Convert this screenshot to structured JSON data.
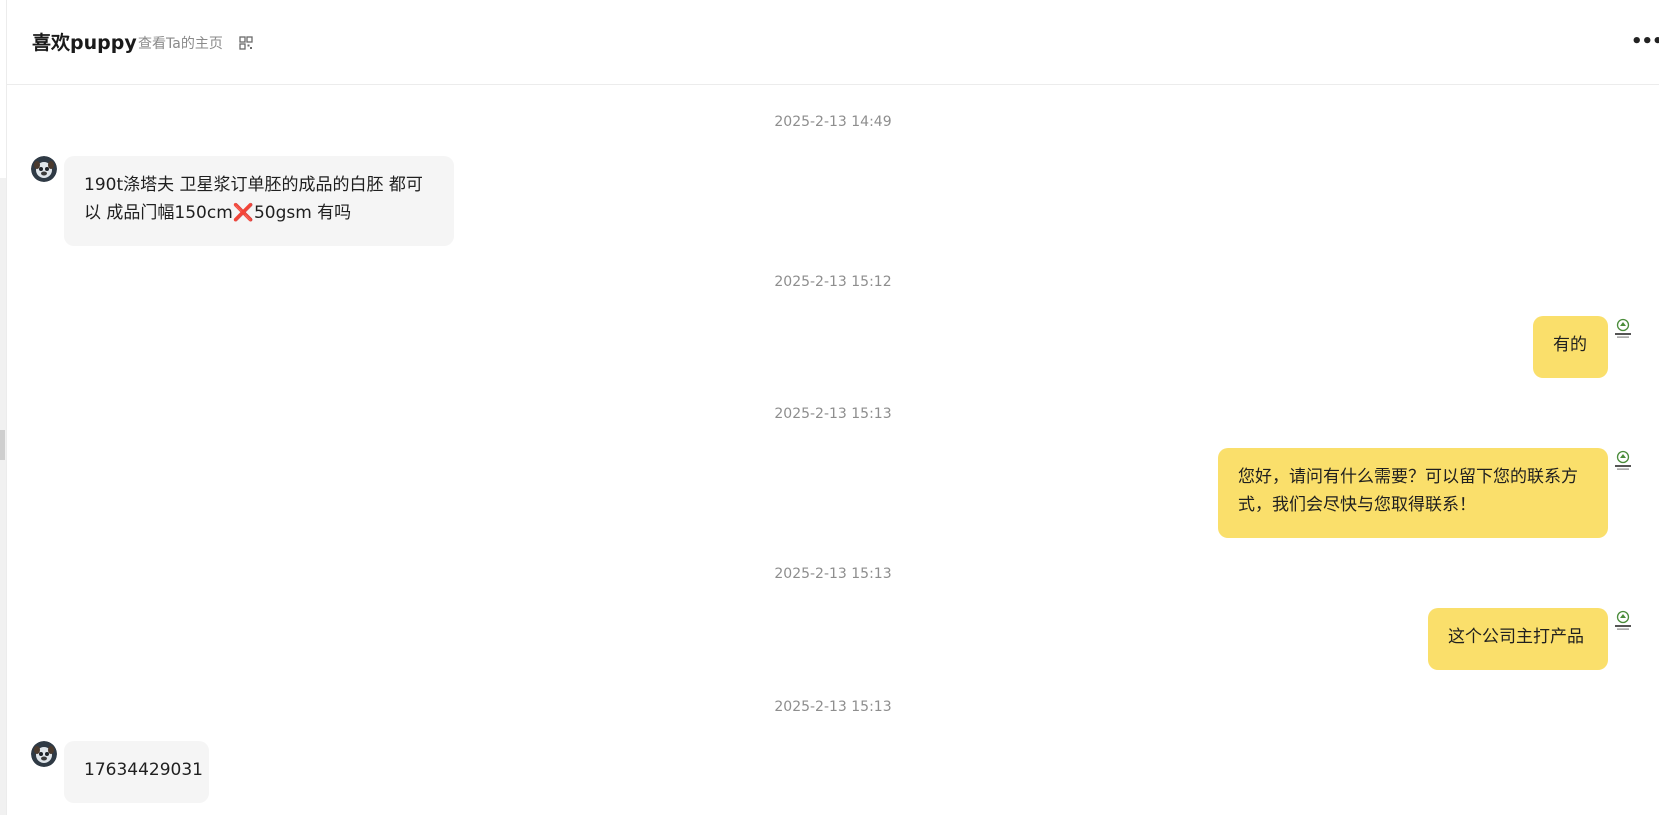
{
  "header": {
    "contact_name": "喜欢puppy",
    "profile_link": "查看Ta的主页",
    "more_icon": "more-horizontal-icon",
    "more_label": "•••"
  },
  "messages": [
    {
      "time": "2025-2-13 14:49",
      "sender": "contact",
      "text_line1": "190t涤塔夫 卫星浆订单胚的成品的白胚 都可",
      "text_line2": "以 成品门幅150cm",
      "text_emoji": "❌",
      "text_line2_rest": "50gsm 有吗"
    },
    {
      "time": "2025-2-13 15:12",
      "sender": "me",
      "text": "有的"
    },
    {
      "time": "2025-2-13 15:13",
      "sender": "me",
      "text_line1": "您好，请问有什么需要？可以留下您的联系方",
      "text_line2": "式，我们会尽快与您取得联系！"
    },
    {
      "time": "2025-2-13 15:13",
      "sender": "me",
      "text": "这个公司主打产品"
    },
    {
      "time": "2025-2-13 15:13",
      "sender": "contact",
      "text": "17634429031"
    }
  ],
  "colors": {
    "incoming_bubble": "#f5f5f5",
    "outgoing_bubble": "#fadf6b",
    "timestamp": "#8e8e8e",
    "cross_emoji": "#7b5cc4"
  }
}
